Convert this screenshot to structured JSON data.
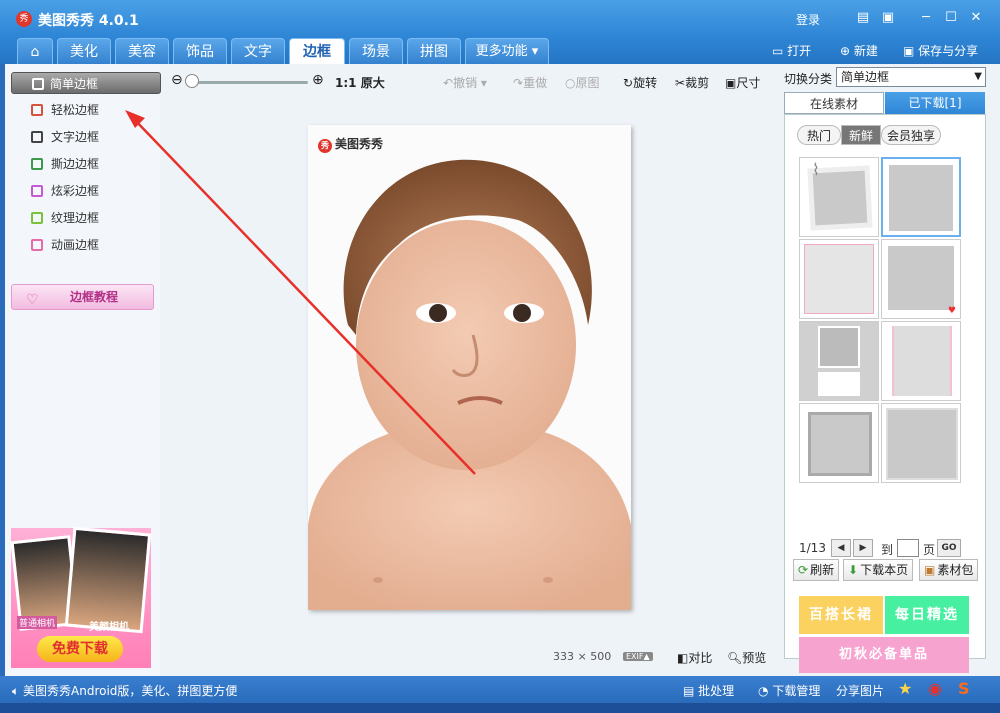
{
  "app": {
    "title": "美图秀秀 4.0.1",
    "icon_text": "秀",
    "login": "登录"
  },
  "window_controls": [
    "msg-icon",
    "skin-icon",
    "minimize-icon",
    "maximize-icon",
    "close-icon"
  ],
  "tabs": [
    {
      "label": "",
      "icon": "home-icon"
    },
    {
      "label": "美化"
    },
    {
      "label": "美容"
    },
    {
      "label": "饰品"
    },
    {
      "label": "文字"
    },
    {
      "label": "边框",
      "active": true
    },
    {
      "label": "场景"
    },
    {
      "label": "拼图"
    },
    {
      "label": "更多功能 ▾"
    }
  ],
  "tab_actions": {
    "open": "打开",
    "new": "新建",
    "save": "保存与分享"
  },
  "sidebar": {
    "items": [
      {
        "label": "简单边框",
        "selected": true
      },
      {
        "label": "轻松边框"
      },
      {
        "label": "文字边框"
      },
      {
        "label": "撕边边框"
      },
      {
        "label": "炫彩边框"
      },
      {
        "label": "纹理边框"
      },
      {
        "label": "动画边框"
      }
    ],
    "tutorial": "边框教程"
  },
  "ad": {
    "label1": "普通相机",
    "label2": "美颜相机",
    "button": "免费下载"
  },
  "toolbar": {
    "zoom_ratio": "1:1",
    "original_size": "原大",
    "undo": "撤销",
    "redo": "重做",
    "original": "原图",
    "rotate": "旋转",
    "crop": "裁剪",
    "size": "尺寸"
  },
  "canvas": {
    "watermark": "美图秀秀",
    "width": "333",
    "times": "×",
    "height": "500",
    "exif": "EXIF▲",
    "compare": "对比",
    "preview": "预览"
  },
  "right_panel": {
    "switch_label": "切换分类",
    "category": "简单边框",
    "tab_online": "在线素材",
    "tab_downloaded": "已下载[1]",
    "subtabs": [
      "热门",
      "新鲜",
      "会员独享"
    ],
    "page": "1/13",
    "goto": "到",
    "page_unit": "页",
    "go": "GO",
    "refresh": "刷新",
    "download_page": "下载本页",
    "material_pack": "素材包",
    "promo1": "百搭长裙",
    "promo2": "每日精选",
    "promo3": "初秋必备单品"
  },
  "statusbar": {
    "message": "美图秀秀Android版，美化、拼图更方便",
    "batch": "批处理",
    "download_mgr": "下载管理",
    "share": "分享图片"
  },
  "colors": {
    "accent": "#2f86d6",
    "arrow": "#e8302a",
    "promo1": "#fbd160",
    "promo2": "#47f0a0",
    "promo3": "#f7a3d0"
  }
}
